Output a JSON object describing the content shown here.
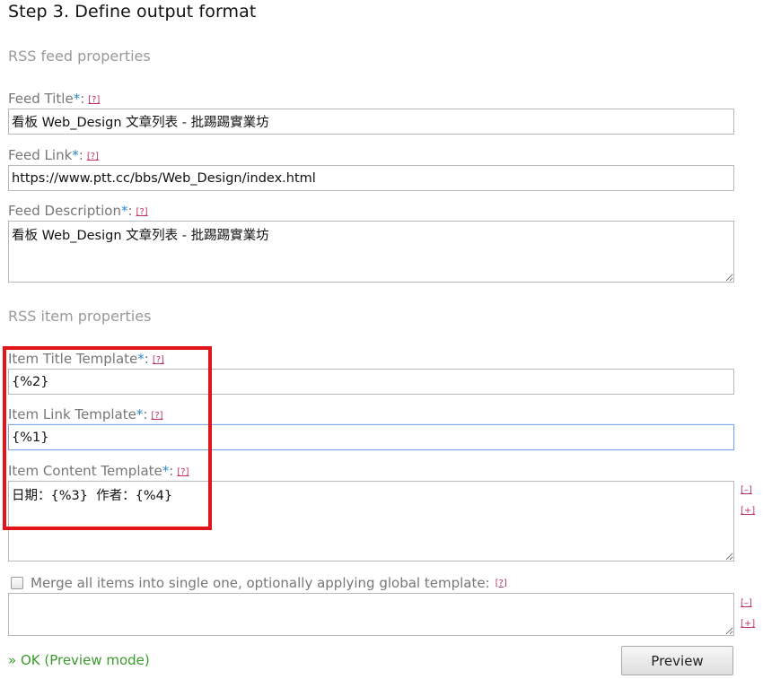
{
  "step_title": "Step 3. Define output format",
  "feed_section": {
    "title": "RSS feed properties",
    "help_text": "[?]",
    "required_mark": "*",
    "feed_title": {
      "label": "Feed Title",
      "value": "看板 Web_Design 文章列表 - 批踢踢實業坊"
    },
    "feed_link": {
      "label": "Feed Link",
      "value": "https://www.ptt.cc/bbs/Web_Design/index.html"
    },
    "feed_description": {
      "label": "Feed Description",
      "value": "看板 Web_Design 文章列表 - 批踢踢實業坊"
    }
  },
  "item_section": {
    "title": "RSS item properties",
    "item_title_template": {
      "label": "Item Title Template",
      "value": "{%2}"
    },
    "item_link_template": {
      "label": "Item Link Template",
      "value": "{%1}"
    },
    "item_content_template": {
      "label": "Item Content Template",
      "value": "日期：{%3}  作者：{%4}",
      "collapse_label": "[–]",
      "expand_label": "[+]"
    }
  },
  "merge": {
    "label": "Merge all items into single one, optionally applying global template:",
    "checked": false,
    "template_value": "",
    "collapse_label": "[–]",
    "expand_label": "[+]"
  },
  "status": {
    "text": "» OK (Preview mode)",
    "color": "#3a9a2c"
  },
  "preview_button": {
    "label": "Preview"
  },
  "colors": {
    "highlight_border": "#e0161a",
    "help_link": "#c0306a",
    "required_star": "#2a8ac8"
  }
}
